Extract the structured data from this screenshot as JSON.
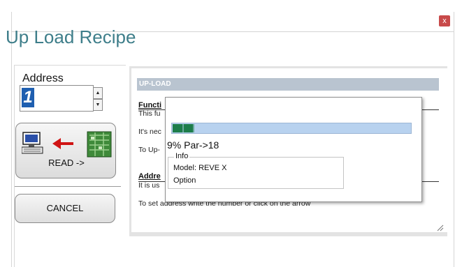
{
  "window": {
    "close_label": "x",
    "title": "Up Load Recipe"
  },
  "left": {
    "address_label": "Address",
    "address_value": "1",
    "read_button_label": "READ ->",
    "cancel_button_label": "CANCEL"
  },
  "help": {
    "header": "UP-LOAD",
    "function_heading": "Functi",
    "function_text": "This fu",
    "line_need": "It's nec",
    "line_upload": "To Up-",
    "address_heading": "Addre",
    "address_text": "It is us",
    "set_address_text": "To set address write the number or click on the arrow"
  },
  "progress_popup": {
    "progress_fraction": 0.09,
    "status_text": "9% Par->18",
    "info_legend": "Info",
    "model_text": "Model: REVE X",
    "option_text": "Option"
  }
}
